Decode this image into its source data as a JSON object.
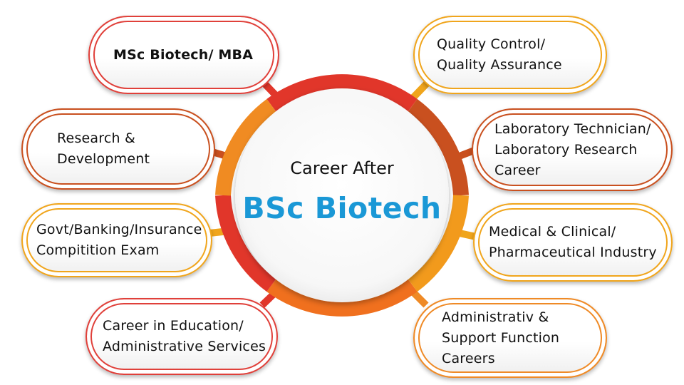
{
  "center": {
    "title": "Career After",
    "heading": "BSc Biotech"
  },
  "colors": {
    "red": "#e1362a",
    "rust": "#c9501f",
    "orange": "#f08b22",
    "amber": "#f0a51c",
    "heading_blue": "#1a98d6"
  },
  "careers": [
    {
      "label": "MSc Biotech/ MBA",
      "color": "#e0403a",
      "bold": true
    },
    {
      "label": "Quality Control/\nQuality Assurance",
      "color": "#f0a51c"
    },
    {
      "label": "Research &\nDevelopment",
      "color": "#c9501f"
    },
    {
      "label": "Laboratory Technician/\nLaboratory Research\nCareer",
      "color": "#c9501f"
    },
    {
      "label": "Govt/Banking/Insurance\nCompitition Exam",
      "color": "#f0a51c"
    },
    {
      "label": "Medical & Clinical/\nPharmaceutical Industry",
      "color": "#f0a51c"
    },
    {
      "label": "Career in Education/\nAdministrative Services",
      "color": "#e0403a"
    },
    {
      "label": "Administrativ &\nSupport Function\n Careers",
      "color": "#ef8a26"
    }
  ]
}
